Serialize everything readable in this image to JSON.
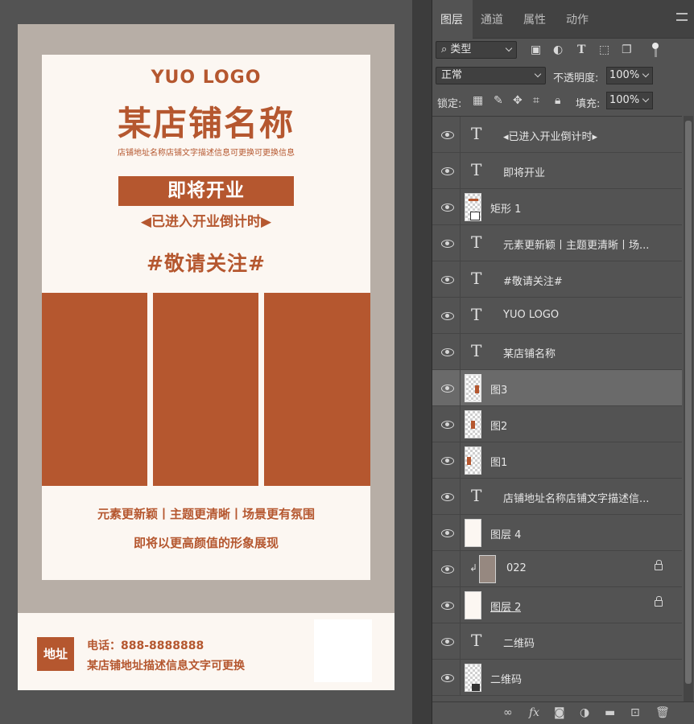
{
  "poster": {
    "logo": "YUO LOGO",
    "shop_name": "某店铺名称",
    "shop_desc": "店铺地址名称店铺文字描述信息可更换可更换信息",
    "opening": "即将开业",
    "countdown": "◀已进入开业倒计时▶",
    "follow": "#敬请关注#",
    "slogan1": "元素更新颖丨主题更清晰丨场景更有氛围",
    "slogan2": "即将以更高颜值的形象展现",
    "address_badge": "地址",
    "phone": "电话：888-8888888",
    "address": "某店铺地址描述信息文字可更换",
    "accent_color": "#b5572f"
  },
  "panel": {
    "tabs": [
      "图层",
      "通道",
      "属性",
      "动作"
    ],
    "filter_kind": "类型",
    "blend_mode": "正常",
    "opacity_label": "不透明度:",
    "opacity_value": "100%",
    "lock_label": "锁定:",
    "fill_label": "填充:",
    "fill_value": "100%",
    "layers": [
      {
        "name": "◂已进入开业倒计时▸",
        "type": "text"
      },
      {
        "name": "即将开业",
        "type": "text"
      },
      {
        "name": "矩形 1",
        "type": "shape"
      },
      {
        "name": "元素更新颖丨主题更清晰丨场...",
        "type": "text"
      },
      {
        "name": "#敬请关注#",
        "type": "text"
      },
      {
        "name": "YUO LOGO",
        "type": "text"
      },
      {
        "name": "某店铺名称",
        "type": "text"
      },
      {
        "name": "图3",
        "type": "pixel",
        "selected": true
      },
      {
        "name": "图2",
        "type": "pixel"
      },
      {
        "name": "图1",
        "type": "pixel"
      },
      {
        "name": "店铺地址名称店铺文字描述信...",
        "type": "text"
      },
      {
        "name": "图层 4",
        "type": "pixel"
      },
      {
        "name": "022",
        "type": "clipped",
        "locked": true
      },
      {
        "name": "图层 2",
        "type": "pixel",
        "locked": true
      },
      {
        "name": "二维码",
        "type": "text"
      },
      {
        "name": "二维码",
        "type": "smart"
      }
    ]
  }
}
